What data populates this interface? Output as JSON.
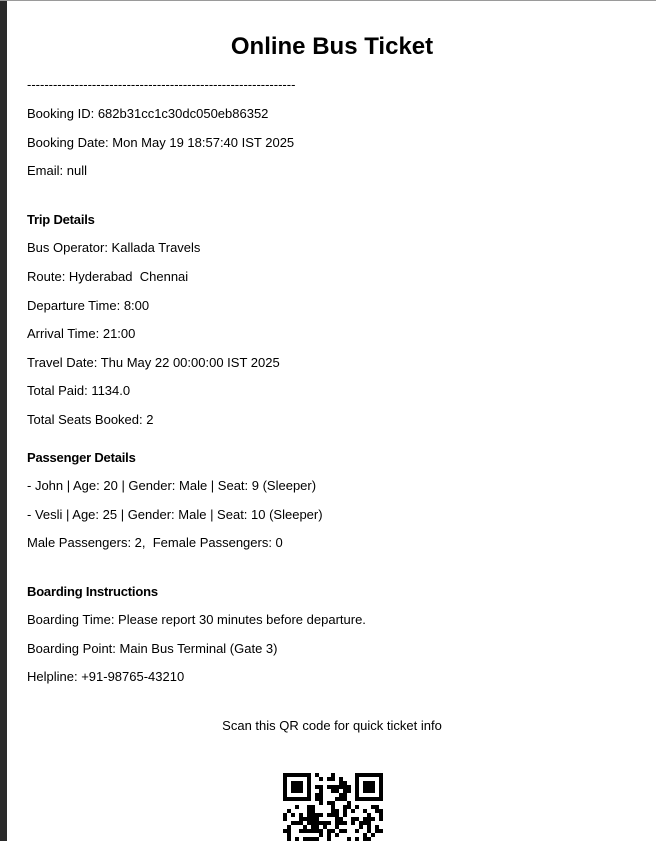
{
  "ticket": {
    "title": "Online Bus Ticket",
    "separator": "--------------------------------------------------------------",
    "booking_id": "Booking ID: 682b31cc1c30dc050eb86352",
    "booking_date": "Booking Date: Mon May 19 18:57:40 IST 2025",
    "email": "Email: null"
  },
  "trip": {
    "heading": "Trip Details",
    "bus_operator": "Bus Operator: Kallada Travels",
    "route": "Route: Hyderabad  Chennai",
    "departure_time": "Departure Time: 8:00",
    "arrival_time": "Arrival Time: 21:00",
    "travel_date": "Travel Date: Thu May 22 00:00:00 IST 2025",
    "total_paid": "Total Paid: 1134.0",
    "total_seats": "Total Seats Booked: 2"
  },
  "passengers": {
    "heading": "Passenger Details",
    "list": [
      "- John | Age: 20 | Gender: Male | Seat: 9 (Sleeper)",
      "- Vesli | Age: 25 | Gender: Male | Seat: 10 (Sleeper)"
    ],
    "summary": "Male Passengers: 2,  Female Passengers: 0"
  },
  "boarding": {
    "heading": "Boarding Instructions",
    "time": "Boarding Time: Please report 30 minutes before departure.",
    "point": "Boarding Point: Main Bus Terminal (Gate 3)",
    "helpline": "Helpline: +91-98765-43210"
  },
  "qr": {
    "caption": "Scan this QR code for quick ticket info",
    "icon": "qr-code-icon"
  }
}
